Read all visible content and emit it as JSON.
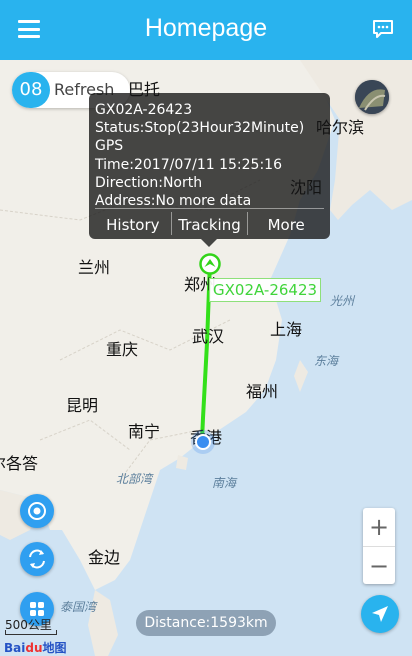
{
  "header": {
    "title": "Homepage"
  },
  "refresh": {
    "count": "08",
    "label": "Refresh"
  },
  "popup": {
    "lines": [
      "GX02A-26423",
      "Status:Stop(23Hour32Minute)",
      "GPS",
      "Time:2017/07/11 15:25:16",
      "Direction:North",
      "Address:No more data"
    ],
    "actions": {
      "history": "History",
      "tracking": "Tracking",
      "more": "More"
    }
  },
  "device_label": "GX02A-26423",
  "cities": {
    "bato": "巴托",
    "harbin": "哈尔滨",
    "shenyang": "沈阳",
    "lanzhou": "兰州",
    "zhengzhou": "郑州",
    "wuhan": "武汉",
    "shanghai": "上海",
    "chongqing": "重庆",
    "fuzhou": "福州",
    "kunming": "昆明",
    "nanning": "南宁",
    "hongkong": "香港",
    "kolkata": "加尔各答",
    "jinbian": "金边",
    "guangzhou": "光州"
  },
  "seas": {
    "donghai": "东海",
    "nanhai": "南海",
    "beibuwan": "北部湾",
    "taiguowan": "泰国湾"
  },
  "controls": {
    "zoom_in": "+",
    "zoom_out": "−"
  },
  "distance": "Distance:1593km",
  "scale": "500公里",
  "logo": {
    "main": "Bai",
    "accent": "du",
    "suffix": "地图"
  },
  "colors": {
    "accent": "#29b3ee",
    "track": "#33e01a",
    "popup": "#141414"
  }
}
